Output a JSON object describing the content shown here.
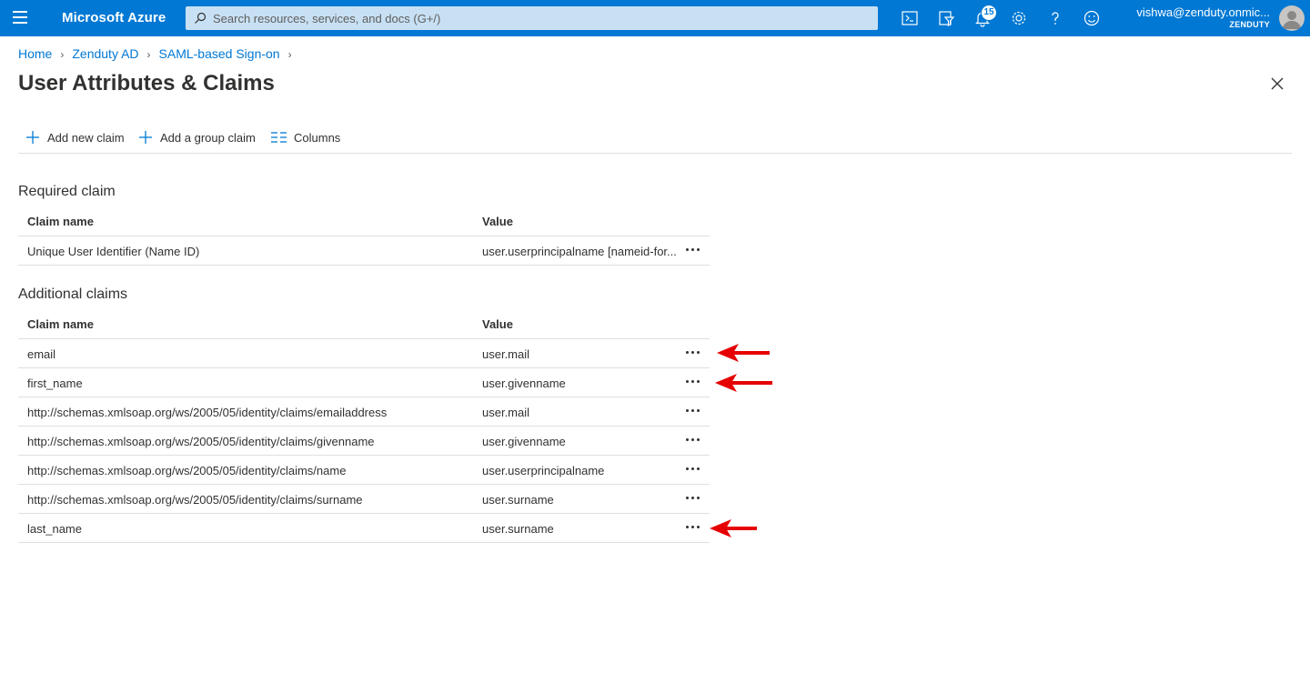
{
  "topbar": {
    "brand": "Microsoft Azure",
    "search_placeholder": "Search resources, services, and docs (G+/)",
    "notifications_count": "15",
    "account_email": "vishwa@zenduty.onmic...",
    "account_tenant": "ZENDUTY",
    "color": "#0078d4"
  },
  "breadcrumb": [
    "Home",
    "Zenduty AD",
    "SAML-based Sign-on"
  ],
  "page": {
    "title": "User Attributes & Claims"
  },
  "commands": {
    "add_claim": "Add new claim",
    "add_group_claim": "Add a group claim",
    "columns": "Columns"
  },
  "required": {
    "title": "Required claim",
    "headers": {
      "name": "Claim name",
      "value": "Value"
    },
    "rows": [
      {
        "name": "Unique User Identifier (Name ID)",
        "value": "user.userprincipalname [nameid-for..."
      }
    ]
  },
  "additional": {
    "title": "Additional claims",
    "headers": {
      "name": "Claim name",
      "value": "Value"
    },
    "rows": [
      {
        "name": "email",
        "value": "user.mail"
      },
      {
        "name": "first_name",
        "value": "user.givenname"
      },
      {
        "name": "http://schemas.xmlsoap.org/ws/2005/05/identity/claims/emailaddress",
        "value": "user.mail"
      },
      {
        "name": "http://schemas.xmlsoap.org/ws/2005/05/identity/claims/givenname",
        "value": "user.givenname"
      },
      {
        "name": "http://schemas.xmlsoap.org/ws/2005/05/identity/claims/name",
        "value": "user.userprincipalname"
      },
      {
        "name": "http://schemas.xmlsoap.org/ws/2005/05/identity/claims/surname",
        "value": "user.surname"
      },
      {
        "name": "last_name",
        "value": "user.surname"
      }
    ]
  },
  "annotation_color": "#e60000"
}
